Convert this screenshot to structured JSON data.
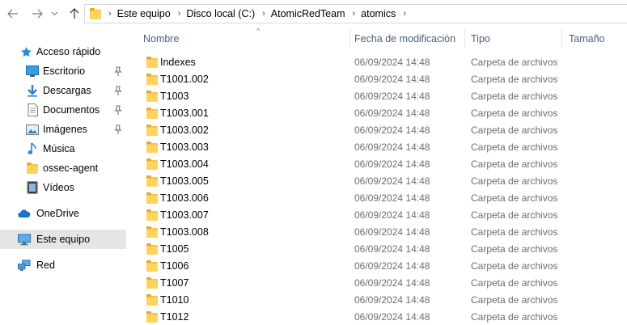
{
  "window": {
    "colors": {
      "selection": "#e5e5e5",
      "header_text": "#4c607a",
      "folder": "#ffd45e"
    }
  },
  "navbar": {
    "back_icon": "arrow-left-icon",
    "forward_icon": "arrow-right-icon",
    "recent_icon": "chevron-down-icon",
    "up_icon": "arrow-up-icon",
    "breadcrumb": [
      {
        "label": "Este equipo"
      },
      {
        "label": "Disco local (C:)"
      },
      {
        "label": "AtomicRedTeam"
      },
      {
        "label": "atomics"
      }
    ]
  },
  "sidebar": {
    "items": [
      {
        "label": "Acceso rápido",
        "icon": "star-icon"
      },
      {
        "label": "Escritorio",
        "icon": "desktop-icon",
        "pinned": true
      },
      {
        "label": "Descargas",
        "icon": "download-icon",
        "pinned": true
      },
      {
        "label": "Documentos",
        "icon": "document-icon",
        "pinned": true
      },
      {
        "label": "Imágenes",
        "icon": "image-icon",
        "pinned": true
      },
      {
        "label": "Música",
        "icon": "music-icon"
      },
      {
        "label": "ossec-agent",
        "icon": "folder-icon"
      },
      {
        "label": "Vídeos",
        "icon": "video-icon"
      },
      {
        "label": "OneDrive",
        "icon": "cloud-icon"
      },
      {
        "label": "Este equipo",
        "icon": "computer-icon",
        "selected": true
      },
      {
        "label": "Red",
        "icon": "network-icon"
      }
    ]
  },
  "columns": {
    "name": "Nombre",
    "modified": "Fecha de modificación",
    "type": "Tipo",
    "size": "Tamaño"
  },
  "files": [
    {
      "name": "Indexes",
      "modified": "06/09/2024 14:48",
      "type": "Carpeta de archivos"
    },
    {
      "name": "T1001.002",
      "modified": "06/09/2024 14:48",
      "type": "Carpeta de archivos"
    },
    {
      "name": "T1003",
      "modified": "06/09/2024 14:48",
      "type": "Carpeta de archivos"
    },
    {
      "name": "T1003.001",
      "modified": "06/09/2024 14:48",
      "type": "Carpeta de archivos"
    },
    {
      "name": "T1003.002",
      "modified": "06/09/2024 14:48",
      "type": "Carpeta de archivos"
    },
    {
      "name": "T1003.003",
      "modified": "06/09/2024 14:48",
      "type": "Carpeta de archivos"
    },
    {
      "name": "T1003.004",
      "modified": "06/09/2024 14:48",
      "type": "Carpeta de archivos"
    },
    {
      "name": "T1003.005",
      "modified": "06/09/2024 14:48",
      "type": "Carpeta de archivos"
    },
    {
      "name": "T1003.006",
      "modified": "06/09/2024 14:48",
      "type": "Carpeta de archivos"
    },
    {
      "name": "T1003.007",
      "modified": "06/09/2024 14:48",
      "type": "Carpeta de archivos"
    },
    {
      "name": "T1003.008",
      "modified": "06/09/2024 14:48",
      "type": "Carpeta de archivos"
    },
    {
      "name": "T1005",
      "modified": "06/09/2024 14:48",
      "type": "Carpeta de archivos"
    },
    {
      "name": "T1006",
      "modified": "06/09/2024 14:48",
      "type": "Carpeta de archivos"
    },
    {
      "name": "T1007",
      "modified": "06/09/2024 14:48",
      "type": "Carpeta de archivos"
    },
    {
      "name": "T1010",
      "modified": "06/09/2024 14:48",
      "type": "Carpeta de archivos"
    },
    {
      "name": "T1012",
      "modified": "06/09/2024 14:48",
      "type": "Carpeta de archivos"
    }
  ]
}
